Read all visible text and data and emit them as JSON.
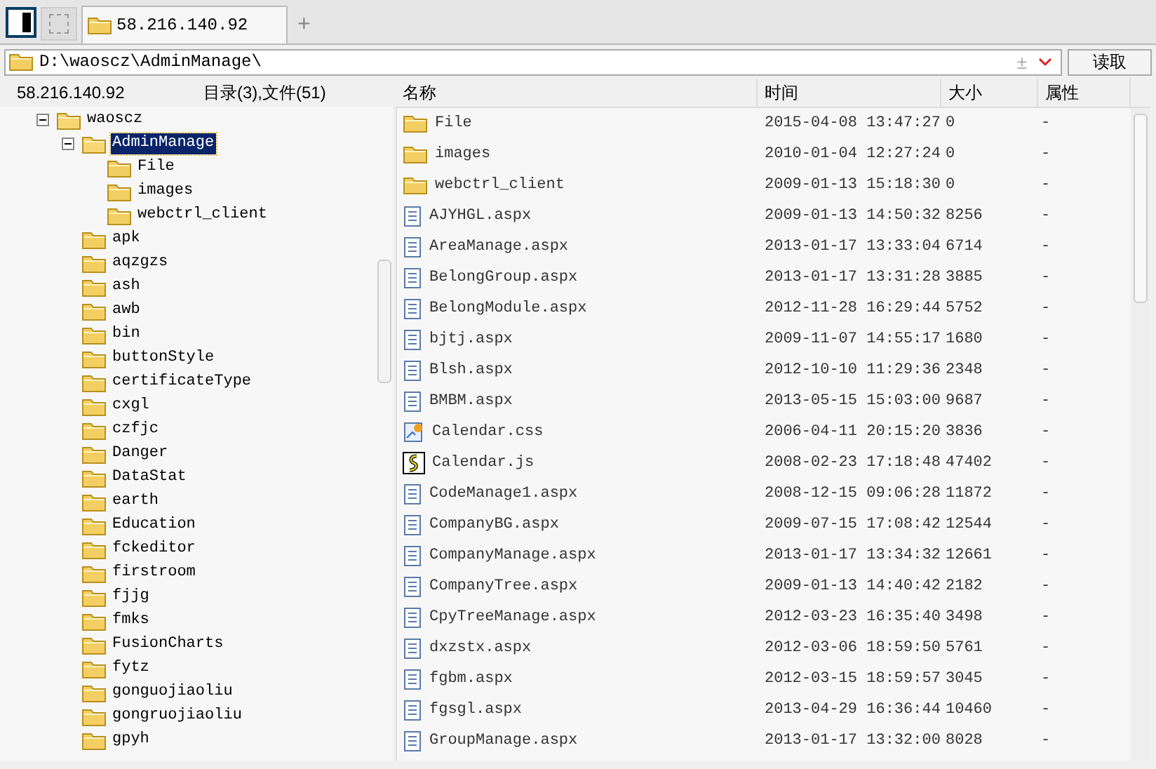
{
  "tabs": [
    {
      "label": "58.216.140.92",
      "selected": true
    }
  ],
  "new_tab": "+",
  "address": {
    "value": "D:\\waoscz\\AdminManage\\",
    "toggle": "±",
    "button": "读取"
  },
  "left_header": {
    "host": "58.216.140.92",
    "summary": "目录(3),文件(51)"
  },
  "tree": [
    {
      "label": "waoscz",
      "expanded": true,
      "selected": false,
      "children": [
        {
          "label": "AdminManage",
          "expanded": true,
          "selected": true,
          "children": [
            {
              "label": "File",
              "selected": false
            },
            {
              "label": "images",
              "selected": false
            },
            {
              "label": "webctrl_client",
              "selected": false
            }
          ]
        },
        {
          "label": "apk",
          "selected": false
        },
        {
          "label": "aqzgzs",
          "selected": false
        },
        {
          "label": "ash",
          "selected": false
        },
        {
          "label": "awb",
          "selected": false
        },
        {
          "label": "bin",
          "selected": false
        },
        {
          "label": "buttonStyle",
          "selected": false
        },
        {
          "label": "certificateType",
          "selected": false
        },
        {
          "label": "cxgl",
          "selected": false
        },
        {
          "label": "czfjc",
          "selected": false
        },
        {
          "label": "Danger",
          "selected": false
        },
        {
          "label": "DataStat",
          "selected": false
        },
        {
          "label": "earth",
          "selected": false
        },
        {
          "label": "Education",
          "selected": false
        },
        {
          "label": "fckeditor",
          "selected": false
        },
        {
          "label": "firstroom",
          "selected": false
        },
        {
          "label": "fjjg",
          "selected": false
        },
        {
          "label": "fmks",
          "selected": false
        },
        {
          "label": "FusionCharts",
          "selected": false
        },
        {
          "label": "fytz",
          "selected": false
        },
        {
          "label": "gonguojiaoliu",
          "selected": false
        },
        {
          "label": "gongruojiaoliu",
          "selected": false
        },
        {
          "label": "gpyh",
          "selected": false
        }
      ]
    }
  ],
  "table": {
    "columns": [
      "名称",
      "时间",
      "大小",
      "属性"
    ],
    "rows": [
      {
        "kind": "folder",
        "name": "File",
        "time": "2015-04-08 13:47:27",
        "size": "0",
        "attr": "-"
      },
      {
        "kind": "folder",
        "name": "images",
        "time": "2010-01-04 12:27:24",
        "size": "0",
        "attr": "-"
      },
      {
        "kind": "folder",
        "name": "webctrl_client",
        "time": "2009-01-13 15:18:30",
        "size": "0",
        "attr": "-"
      },
      {
        "kind": "page",
        "name": "AJYHGL.aspx",
        "time": "2009-01-13 14:50:32",
        "size": "8256",
        "attr": "-"
      },
      {
        "kind": "page",
        "name": "AreaManage.aspx",
        "time": "2013-01-17 13:33:04",
        "size": "6714",
        "attr": "-"
      },
      {
        "kind": "page",
        "name": "BelongGroup.aspx",
        "time": "2013-01-17 13:31:28",
        "size": "3885",
        "attr": "-"
      },
      {
        "kind": "page",
        "name": "BelongModule.aspx",
        "time": "2012-11-28 16:29:44",
        "size": "5752",
        "attr": "-"
      },
      {
        "kind": "page",
        "name": "bjtj.aspx",
        "time": "2009-11-07 14:55:17",
        "size": "1680",
        "attr": "-"
      },
      {
        "kind": "page",
        "name": "Blsh.aspx",
        "time": "2012-10-10 11:29:36",
        "size": "2348",
        "attr": "-"
      },
      {
        "kind": "page",
        "name": "BMBM.aspx",
        "time": "2013-05-15 15:03:00",
        "size": "9687",
        "attr": "-"
      },
      {
        "kind": "style",
        "name": "Calendar.css",
        "time": "2006-04-11 20:15:20",
        "size": "3836",
        "attr": "-"
      },
      {
        "kind": "script",
        "name": "Calendar.js",
        "time": "2008-02-23 17:18:48",
        "size": "47402",
        "attr": "-"
      },
      {
        "kind": "page",
        "name": "CodeManage1.aspx",
        "time": "2008-12-15 09:06:28",
        "size": "11872",
        "attr": "-"
      },
      {
        "kind": "page",
        "name": "CompanyBG.aspx",
        "time": "2009-07-15 17:08:42",
        "size": "12544",
        "attr": "-"
      },
      {
        "kind": "page",
        "name": "CompanyManage.aspx",
        "time": "2013-01-17 13:34:32",
        "size": "12661",
        "attr": "-"
      },
      {
        "kind": "page",
        "name": "CompanyTree.aspx",
        "time": "2009-01-13 14:40:42",
        "size": "2182",
        "attr": "-"
      },
      {
        "kind": "page",
        "name": "CpyTreeManage.aspx",
        "time": "2012-03-23 16:35:40",
        "size": "3498",
        "attr": "-"
      },
      {
        "kind": "page",
        "name": "dxzstx.aspx",
        "time": "2012-03-06 18:59:50",
        "size": "5761",
        "attr": "-"
      },
      {
        "kind": "page",
        "name": "fgbm.aspx",
        "time": "2012-03-15 18:59:57",
        "size": "3045",
        "attr": "-"
      },
      {
        "kind": "page",
        "name": "fgsgl.aspx",
        "time": "2013-04-29 16:36:44",
        "size": "10460",
        "attr": "-"
      },
      {
        "kind": "page",
        "name": "GroupManage.aspx",
        "time": "2013-01-17 13:32:00",
        "size": "8028",
        "attr": "-"
      }
    ]
  }
}
